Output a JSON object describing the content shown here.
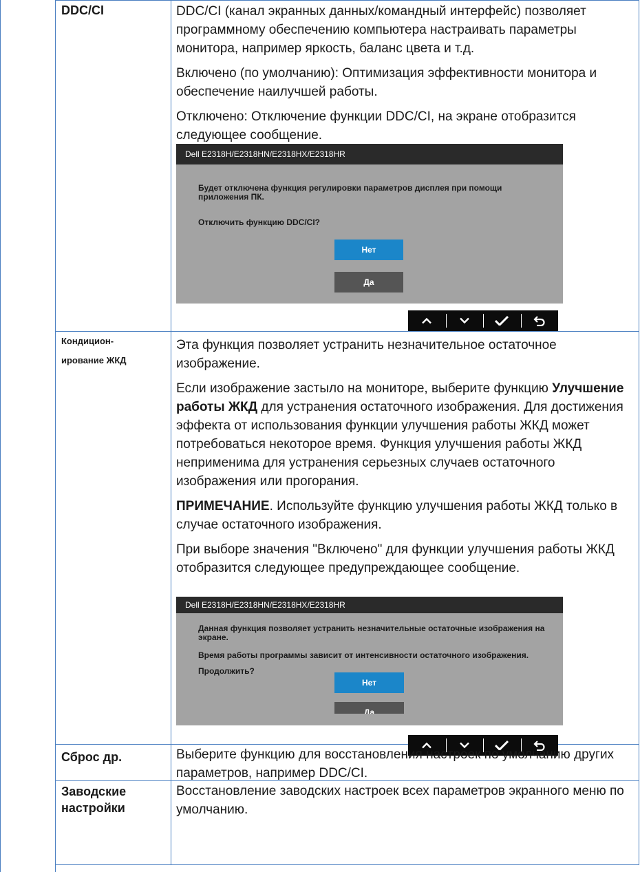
{
  "rows": {
    "ddc": {
      "label": "DDC/CI",
      "p1": "DDC/CI (канал экранных данных/командный интерфейс) позволяет программному обеспечению компьютера настраивать параметры монитора, например яркость, баланс цвета и т.д.",
      "p2": "Включено (по умолчанию): Оптимизация эффективности монитора и обеспечение наилучшей работы.",
      "p3": "Отключено: Отключение функции DDC/CI, на экране отобразится следующее сообщение.",
      "dialog": {
        "title": "Dell E2318H/E2318HN/E2318HX/E2318HR",
        "line1": "Будет отключена функция регулировки параметров дисплея при помощи приложения ПК.",
        "line2": "Отключить функцию DDC/CI?",
        "no": "Нет",
        "yes": "Да"
      }
    },
    "lcd": {
      "label_line1": "Кондицион-",
      "label_line2": "ирование ЖКД",
      "p1": "Эта функция позволяет устранить незначительное остаточное изображение.",
      "p2_a": "Если изображение застыло на мониторе, выберите функцию ",
      "p2_bold": "Улучшение работы ЖКД",
      "p2_b": " для устранения остаточного изображения. Для достижения эффекта от использования функции улучшения работы ЖКД может потребоваться некоторое время. Функция улучшения работы ЖКД неприменима для устранения серьезных случаев остаточного изображения или прогорания.",
      "p3_bold": "ПРИМЕЧАНИЕ",
      "p3_rest": ". Используйте функцию улучшения работы ЖКД только в случае остаточного изображения.",
      "p4": "При выборе значения \"Включено\" для функции улучшения работы ЖКД отобразится следующее предупреждающее сообщение.",
      "dialog": {
        "title": "Dell E2318H/E2318HN/E2318HX/E2318HR",
        "line1": "Данная функция позволяет устранить незначительные остаточные изображения на экране.",
        "line2": "Время работы программы зависит от интенсивности остаточного изображения.",
        "line3": "Продолжить?",
        "no": "Нет",
        "yes": "Да"
      }
    },
    "reset": {
      "label": "Сброс др.",
      "desc": "Выберите функцию для восстановления настроек по умолчанию других параметров, например DDC/CI."
    },
    "factory": {
      "label_line1": "Заводские",
      "label_line2": "настройки",
      "desc": "Восстановление заводских настроек всех параметров экранного меню по умолчанию."
    }
  },
  "nav_icons": [
    "up-icon",
    "down-icon",
    "check-icon",
    "back-icon"
  ]
}
